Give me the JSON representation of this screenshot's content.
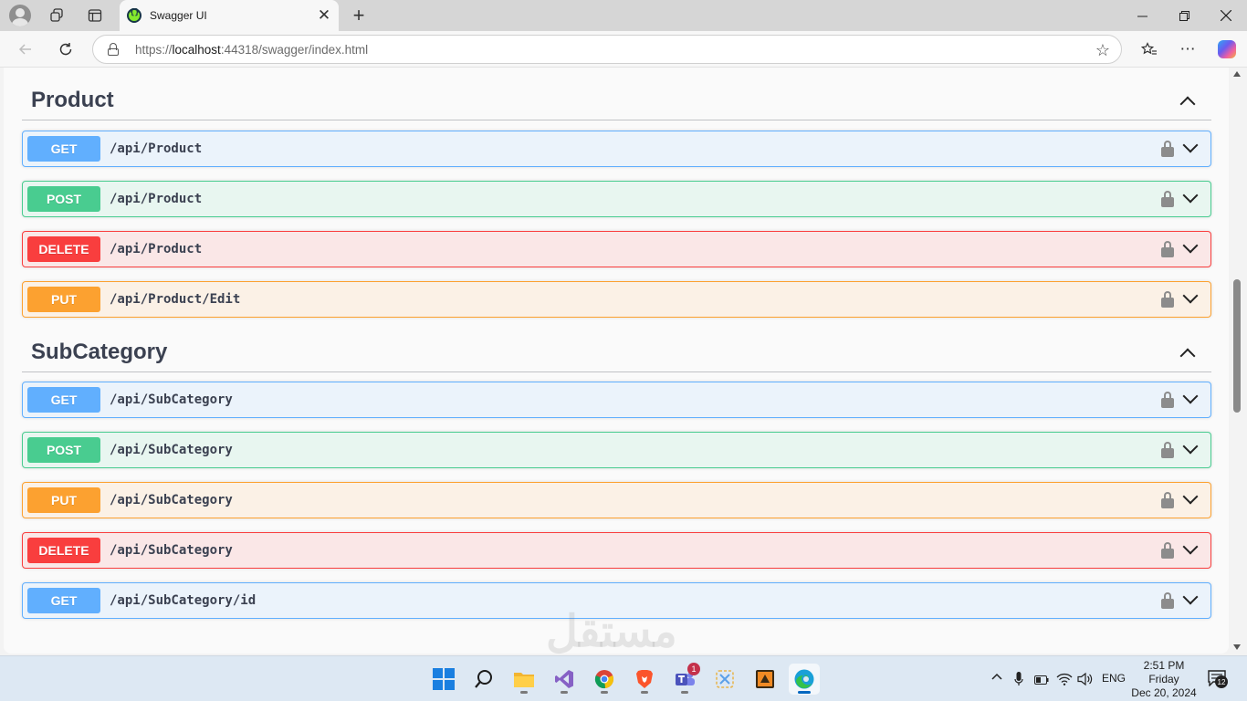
{
  "browser": {
    "tab_title": "Swagger UI",
    "url_scheme": "https://",
    "url_host": "localhost",
    "url_rest": ":44318/swagger/index.html"
  },
  "sections": [
    {
      "title": "Product",
      "operations": [
        {
          "method": "GET",
          "path": "/api/Product"
        },
        {
          "method": "POST",
          "path": "/api/Product"
        },
        {
          "method": "DELETE",
          "path": "/api/Product"
        },
        {
          "method": "PUT",
          "path": "/api/Product/Edit"
        }
      ]
    },
    {
      "title": "SubCategory",
      "operations": [
        {
          "method": "GET",
          "path": "/api/SubCategory"
        },
        {
          "method": "POST",
          "path": "/api/SubCategory"
        },
        {
          "method": "PUT",
          "path": "/api/SubCategory"
        },
        {
          "method": "DELETE",
          "path": "/api/SubCategory"
        },
        {
          "method": "GET",
          "path": "/api/SubCategory/id"
        }
      ]
    }
  ],
  "method_colors": {
    "GET": "#61affe",
    "POST": "#49cc90",
    "DELETE": "#f93e3e",
    "PUT": "#fca130"
  },
  "taskbar": {
    "language": "ENG",
    "time": "2:51 PM",
    "day": "Friday",
    "date": "Dec 20, 2024",
    "notification_count": "12",
    "teams_badge": "1"
  },
  "watermark": "مستقل"
}
